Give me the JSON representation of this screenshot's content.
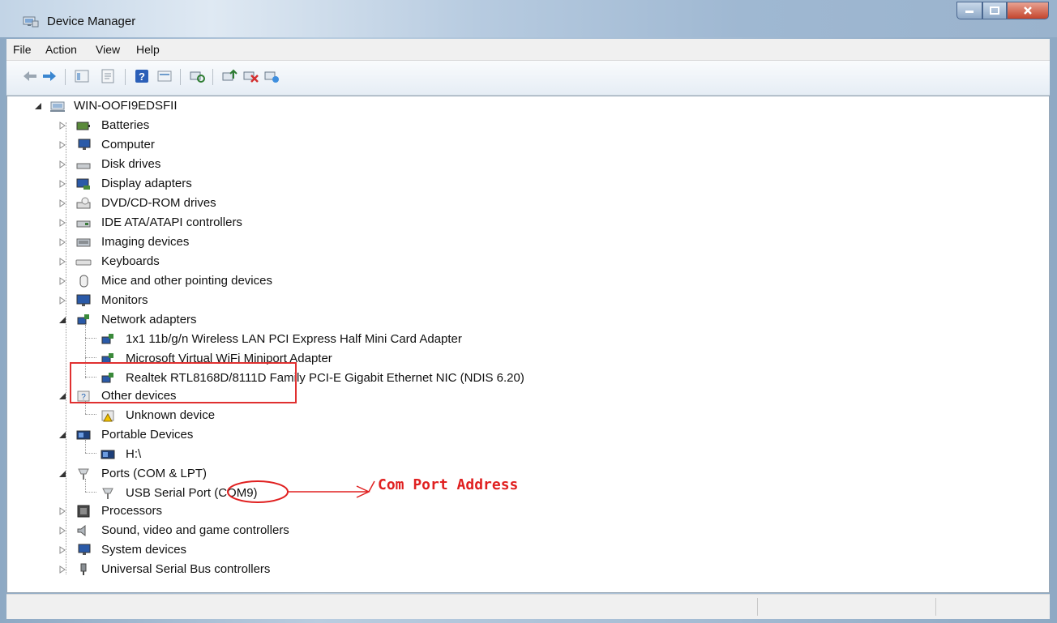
{
  "window": {
    "title": "Device Manager"
  },
  "menu": {
    "file": "File",
    "action": "Action",
    "view": "View",
    "help": "Help"
  },
  "tree": {
    "root": "WIN-OOFI9EDSFII",
    "batteries": "Batteries",
    "computer": "Computer",
    "disk_drives": "Disk drives",
    "display_adapters": "Display adapters",
    "dvd": "DVD/CD-ROM drives",
    "ide": "IDE ATA/ATAPI controllers",
    "imaging": "Imaging devices",
    "keyboards": "Keyboards",
    "mice": "Mice and other pointing devices",
    "monitors": "Monitors",
    "network_adapters": "Network adapters",
    "net_1": "1x1 11b/g/n Wireless LAN PCI Express Half Mini Card Adapter",
    "net_2": "Microsoft Virtual WiFi Miniport Adapter",
    "net_3": "Realtek RTL8168D/8111D Family PCI-E Gigabit Ethernet NIC (NDIS 6.20)",
    "other_devices": "Other devices",
    "unknown_device": "Unknown device",
    "portable_devices": "Portable Devices",
    "portable_h": "H:\\",
    "ports": "Ports (COM & LPT)",
    "usb_serial_prefix": "USB Serial Port ",
    "usb_serial_com": "(COM9)",
    "processors": "Processors",
    "sound": "Sound, video and game controllers",
    "system_devices": "System devices",
    "usb_controllers": "Universal Serial Bus controllers"
  },
  "annotation": {
    "text": "Com Port Address",
    "color": "#e02020"
  }
}
